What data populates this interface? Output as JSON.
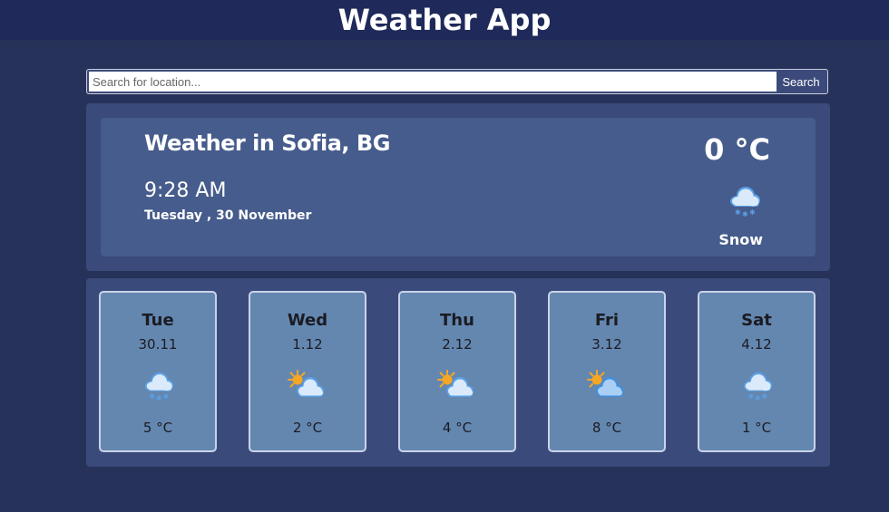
{
  "app": {
    "title": "Weather App"
  },
  "search": {
    "placeholder": "Search for location...",
    "button_label": "Search"
  },
  "current": {
    "title": "Weather in Sofia, BG",
    "time": "9:28 AM",
    "date": "Tuesday , 30 November",
    "temperature": "0 °C",
    "condition": "Snow",
    "icon": "snow-icon"
  },
  "forecast": [
    {
      "day": "Tue",
      "date": "30.11",
      "temp": "5 °C",
      "icon": "snow-icon"
    },
    {
      "day": "Wed",
      "date": "1.12",
      "temp": "2 °C",
      "icon": "partly-cloudy-icon"
    },
    {
      "day": "Thu",
      "date": "2.12",
      "temp": "4 °C",
      "icon": "partly-cloudy-icon"
    },
    {
      "day": "Fri",
      "date": "3.12",
      "temp": "8 °C",
      "icon": "partly-cloudy-icon"
    },
    {
      "day": "Sat",
      "date": "4.12",
      "temp": "1 °C",
      "icon": "snow-icon"
    }
  ],
  "colors": {
    "background": "#263259",
    "header": "#1f2a5a",
    "panel": "#3a4a7a",
    "current_inner": "#465c8c",
    "card": "#6487b0",
    "card_border": "#c9d3ea"
  }
}
